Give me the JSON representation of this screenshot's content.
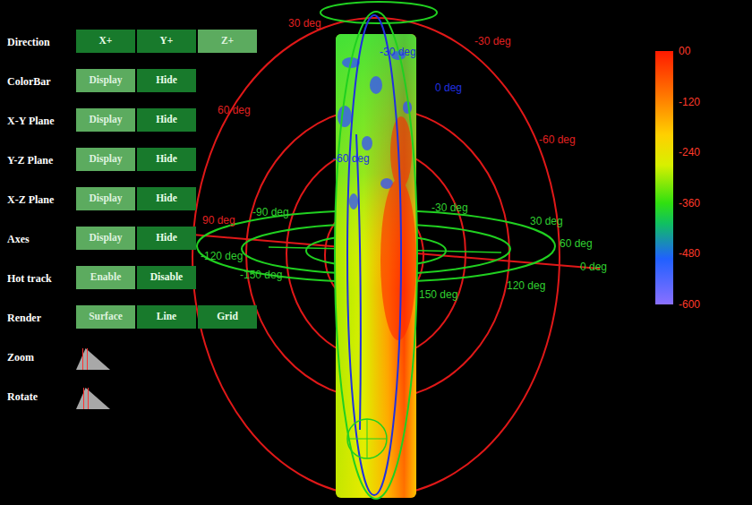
{
  "controls": [
    {
      "label": "Direction",
      "kind": "buttons",
      "buttons": [
        {
          "label": "X+",
          "selected": false
        },
        {
          "label": "Y+",
          "selected": false
        },
        {
          "label": "Z+",
          "selected": true
        }
      ]
    },
    {
      "label": "ColorBar",
      "kind": "buttons",
      "buttons": [
        {
          "label": "Display",
          "selected": true
        },
        {
          "label": "Hide",
          "selected": false
        }
      ]
    },
    {
      "label": "X-Y Plane",
      "kind": "buttons",
      "buttons": [
        {
          "label": "Display",
          "selected": true
        },
        {
          "label": "Hide",
          "selected": false
        }
      ]
    },
    {
      "label": "Y-Z Plane",
      "kind": "buttons",
      "buttons": [
        {
          "label": "Display",
          "selected": true
        },
        {
          "label": "Hide",
          "selected": false
        }
      ]
    },
    {
      "label": "X-Z Plane",
      "kind": "buttons",
      "buttons": [
        {
          "label": "Display",
          "selected": true
        },
        {
          "label": "Hide",
          "selected": false
        }
      ]
    },
    {
      "label": "Axes",
      "kind": "buttons",
      "buttons": [
        {
          "label": "Display",
          "selected": true
        },
        {
          "label": "Hide",
          "selected": false
        }
      ]
    },
    {
      "label": "Hot track",
      "kind": "buttons",
      "buttons": [
        {
          "label": "Enable",
          "selected": true
        },
        {
          "label": "Disable",
          "selected": false
        }
      ]
    },
    {
      "label": "Render",
      "kind": "buttons",
      "buttons": [
        {
          "label": "Surface",
          "selected": true
        },
        {
          "label": "Line",
          "selected": false
        },
        {
          "label": "Grid",
          "selected": false
        }
      ]
    },
    {
      "label": "Zoom",
      "kind": "slider",
      "level": 0.25
    },
    {
      "label": "Rotate",
      "kind": "slider",
      "level": 0.3
    }
  ],
  "plot": {
    "labels": [
      {
        "text": "30 deg",
        "color": "#e02020"
      },
      {
        "text": "-30 deg",
        "color": "#e02020"
      },
      {
        "text": "60 deg",
        "color": "#e02020"
      },
      {
        "text": "-60 deg",
        "color": "#e02020"
      },
      {
        "text": "90 deg",
        "color": "#e02020"
      },
      {
        "text": "-90 deg",
        "color": "#30d030"
      },
      {
        "text": "-30 deg",
        "color": "#30d030"
      },
      {
        "text": "30 deg",
        "color": "#30d030"
      },
      {
        "text": "60 deg",
        "color": "#30d030"
      },
      {
        "text": "-120 deg",
        "color": "#30d030"
      },
      {
        "text": "-150 deg",
        "color": "#30d030"
      },
      {
        "text": "150 deg",
        "color": "#30d030"
      },
      {
        "text": "120 deg",
        "color": "#30d030"
      },
      {
        "text": "0 deg",
        "color": "#30d030"
      },
      {
        "text": "-30 deg",
        "color": "#2030e0"
      },
      {
        "text": "0 deg",
        "color": "#2030e0"
      },
      {
        "text": "-60 deg",
        "color": "#2030e0"
      }
    ]
  },
  "colorbar": {
    "ticks": [
      "00",
      "-120",
      "-240",
      "-360",
      "-480",
      "-600"
    ]
  }
}
